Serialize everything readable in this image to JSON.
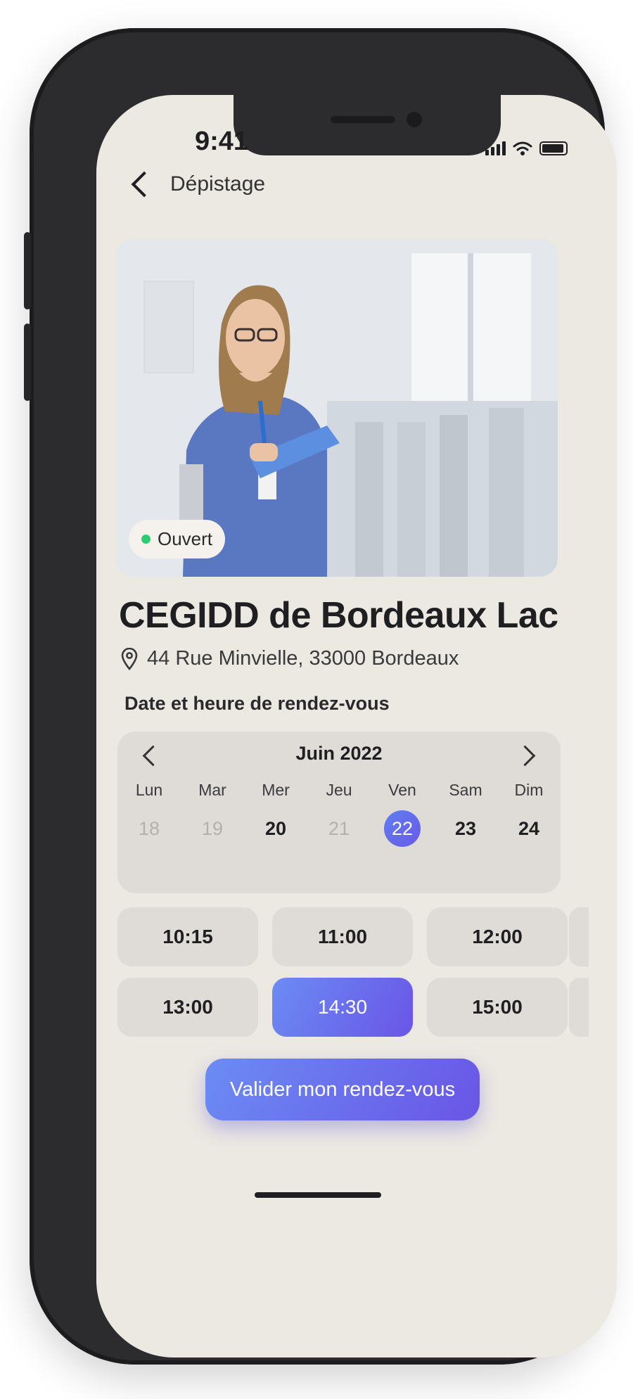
{
  "status_bar": {
    "time": "9:41"
  },
  "nav": {
    "title": "Dépistage"
  },
  "hero": {
    "status_badge": "Ouvert",
    "status_color": "#2ecc71"
  },
  "center": {
    "name": "CEGIDD de Bordeaux Lac",
    "address": "44 Rue Minvielle, 33000 Bordeaux"
  },
  "appointment": {
    "label": "Date et heure de rendez-vous",
    "calendar": {
      "month": "Juin 2022",
      "days": [
        {
          "name": "Lun",
          "num": "18",
          "state": "disabled"
        },
        {
          "name": "Mar",
          "num": "19",
          "state": "disabled"
        },
        {
          "name": "Mer",
          "num": "20",
          "state": "available"
        },
        {
          "name": "Jeu",
          "num": "21",
          "state": "disabled"
        },
        {
          "name": "Ven",
          "num": "22",
          "state": "selected"
        },
        {
          "name": "Sam",
          "num": "23",
          "state": "available"
        },
        {
          "name": "Dim",
          "num": "24",
          "state": "available"
        }
      ]
    },
    "time_slots": [
      {
        "time": "10:15",
        "selected": false
      },
      {
        "time": "11:00",
        "selected": false
      },
      {
        "time": "12:00",
        "selected": false
      },
      {
        "time": "13:00",
        "selected": false
      },
      {
        "time": "14:30",
        "selected": true
      },
      {
        "time": "15:00",
        "selected": false
      }
    ]
  },
  "cta": {
    "label": "Valider mon rendez-vous"
  },
  "colors": {
    "accent_start": "#6b8cf4",
    "accent_end": "#6a55e6",
    "background": "#ece8e2"
  }
}
